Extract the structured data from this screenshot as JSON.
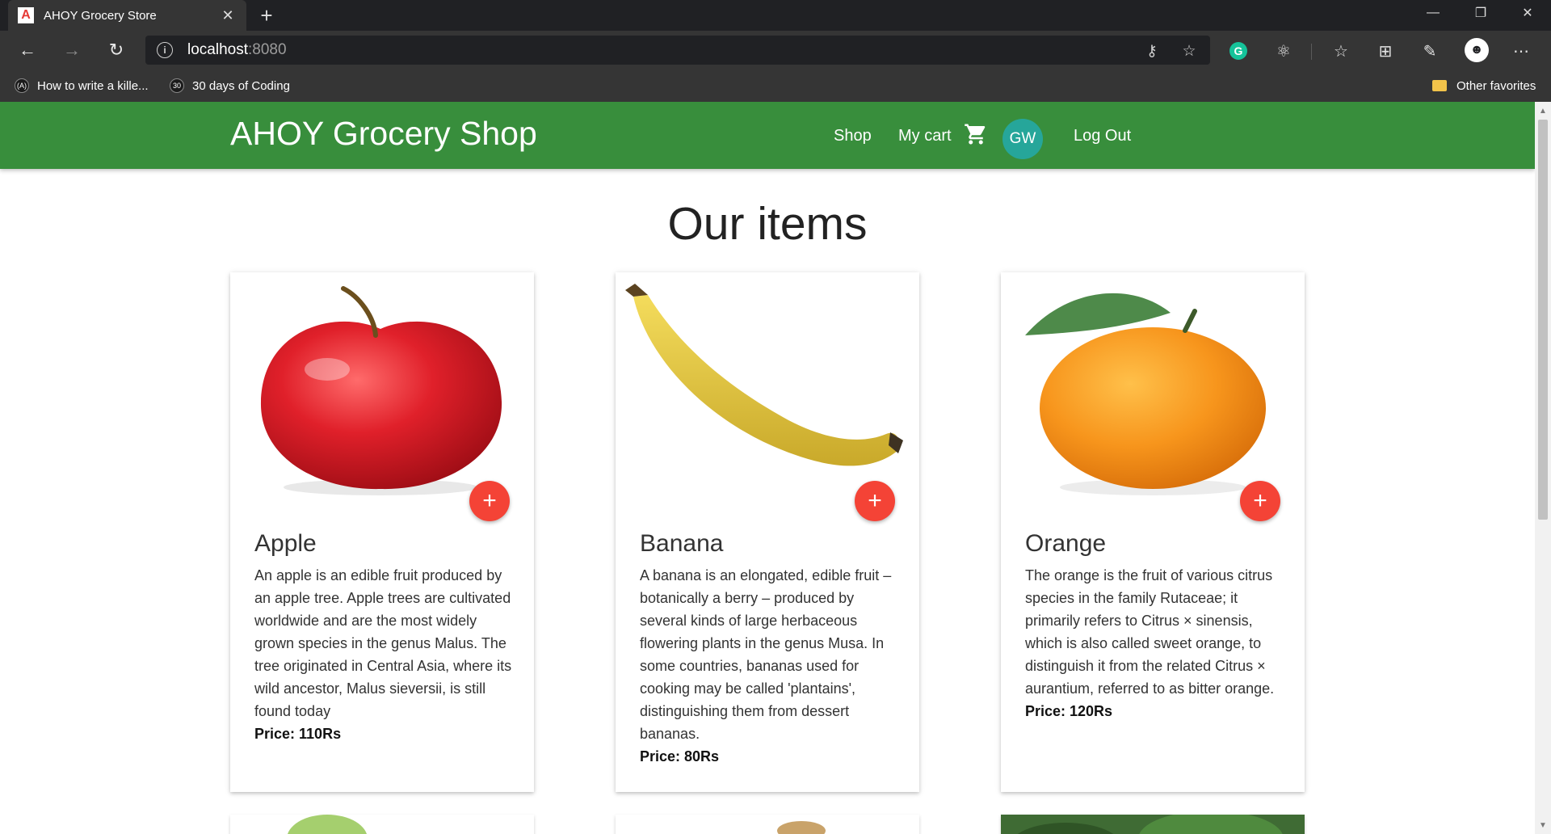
{
  "browser": {
    "tab_title": "AHOY Grocery Store",
    "tab_favicon": "A",
    "url_host": "localhost",
    "url_port": ":8080",
    "bookmarks": [
      {
        "label": "How to write a kille...",
        "icon": "(A)"
      },
      {
        "label": "30 days of Coding",
        "icon": "30"
      }
    ],
    "other_favorites": "Other favorites",
    "profile_initial": "☻"
  },
  "header": {
    "brand": "AHOY Grocery Shop",
    "nav": {
      "shop": "Shop",
      "cart": "My cart",
      "logout": "Log Out"
    },
    "avatar_initials": "GW"
  },
  "main": {
    "heading": "Our items",
    "items": [
      {
        "name": "Apple",
        "description": "An apple is an edible fruit produced by an apple tree. Apple trees are cultivated worldwide and are the most widely grown species in the genus Malus. The tree originated in Central Asia, where its wild ancestor, Malus sieversii, is still found today",
        "price": "Price: 110Rs"
      },
      {
        "name": "Banana",
        "description": "A banana is an elongated, edible fruit – botanically a berry – produced by several kinds of large herbaceous flowering plants in the genus Musa. In some countries, bananas used for cooking may be called 'plantains', distinguishing them from dessert bananas.",
        "price": "Price: 80Rs"
      },
      {
        "name": "Orange",
        "description": "The orange is the fruit of various citrus species in the family Rutaceae; it primarily refers to Citrus × sinensis, which is also called sweet orange, to distinguish it from the related Citrus × aurantium, referred to as bitter orange.",
        "price": "Price: 120Rs"
      }
    ]
  },
  "colors": {
    "appbar": "#388e3c",
    "avatar": "#26a69a",
    "fab": "#f44336"
  },
  "icons": {
    "back": "back-arrow-icon",
    "forward": "forward-arrow-icon",
    "refresh": "refresh-icon",
    "cart": "shopping-cart-icon",
    "add": "plus-icon"
  }
}
